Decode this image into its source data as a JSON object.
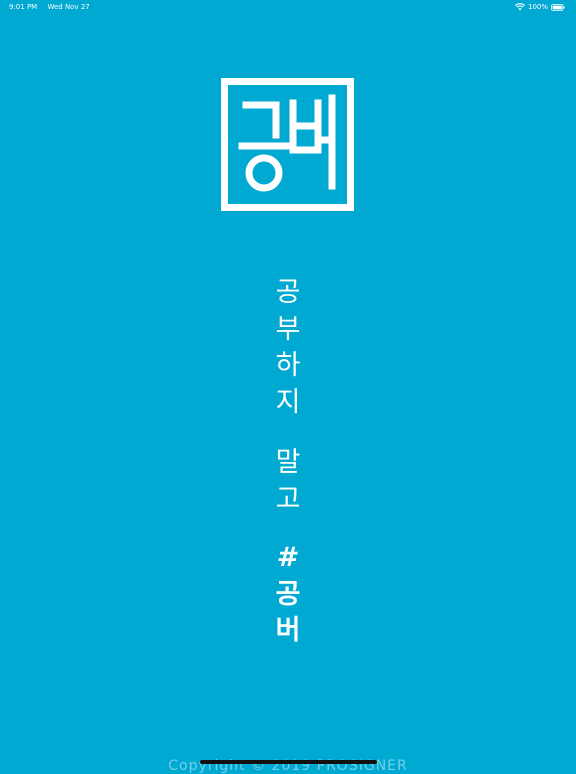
{
  "status_bar": {
    "time": "9:01 PM",
    "date": "Wed Nov 27",
    "battery": "100%"
  },
  "icons": {
    "wifi": "wifi-icon",
    "battery": "battery-icon",
    "logo": "gongbeo-logo"
  },
  "logo": {
    "text": "공버"
  },
  "tagline": {
    "line1": [
      "공",
      "부",
      "하",
      "지"
    ],
    "line2": [
      "말",
      "고"
    ],
    "line3": [
      "#",
      "공",
      "버"
    ]
  },
  "footer": {
    "copyright": "Copyright © 2019 PROSIGNER"
  },
  "colors": {
    "background": "#00a9d2",
    "foreground": "#ffffff"
  }
}
